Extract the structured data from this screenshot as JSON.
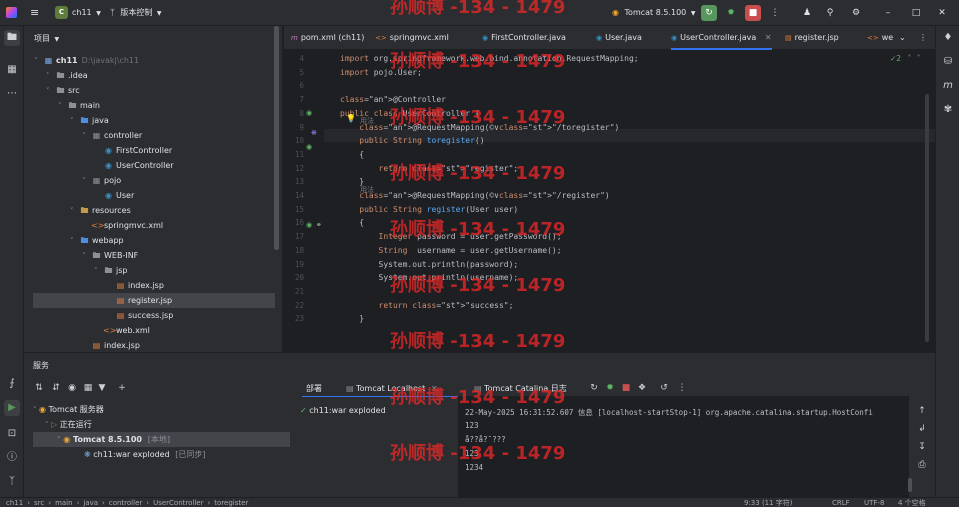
{
  "title_bar": {
    "project_badge": "C",
    "project_name": "ch11",
    "branch": "版本控制",
    "run_config": "Tomcat 8.5.100"
  },
  "project_panel": {
    "title": "项目",
    "tree": [
      {
        "label": "ch11",
        "hint": "D:\\javakj\\ch11",
        "icon": "module-icon"
      },
      {
        "label": ".idea",
        "icon": "folder-icon"
      },
      {
        "label": "src",
        "icon": "folder-icon"
      },
      {
        "label": "main",
        "icon": "folder-icon"
      },
      {
        "label": "java",
        "icon": "source-folder-icon"
      },
      {
        "label": "controller",
        "icon": "package-icon"
      },
      {
        "label": "FirstController",
        "icon": "class-icon"
      },
      {
        "label": "UserController",
        "icon": "class-icon"
      },
      {
        "label": "pojo",
        "icon": "package-icon"
      },
      {
        "label": "User",
        "icon": "class-icon"
      },
      {
        "label": "resources",
        "icon": "resources-folder-icon"
      },
      {
        "label": "springmvc.xml",
        "icon": "xml-file-icon"
      },
      {
        "label": "webapp",
        "icon": "web-folder-icon"
      },
      {
        "label": "WEB-INF",
        "icon": "folder-icon"
      },
      {
        "label": "jsp",
        "icon": "folder-icon"
      },
      {
        "label": "index.jsp",
        "icon": "jsp-file-icon"
      },
      {
        "label": "register.jsp",
        "icon": "jsp-file-icon"
      },
      {
        "label": "success.jsp",
        "icon": "jsp-file-icon"
      },
      {
        "label": "web.xml",
        "icon": "xml-file-icon"
      },
      {
        "label": "index.jsp",
        "icon": "jsp-file-icon"
      }
    ]
  },
  "editor_tabs": [
    {
      "label": "pom.xml (ch11)",
      "icon": "maven-icon"
    },
    {
      "label": "springmvc.xml",
      "icon": "xml-file-icon"
    },
    {
      "label": "FirstController.java",
      "icon": "class-icon"
    },
    {
      "label": "User.java",
      "icon": "class-icon"
    },
    {
      "label": "UserController.java",
      "icon": "class-icon",
      "active": true
    },
    {
      "label": "register.jsp",
      "icon": "jsp-file-icon"
    },
    {
      "label": "we",
      "icon": "xml-file-icon"
    }
  ],
  "editor": {
    "inspection_count": "2",
    "lines": [
      {
        "num": "4",
        "code": "import org.springframework.web.bind.annotation.RequestMapping;"
      },
      {
        "num": "5",
        "code": "import pojo.User;"
      },
      {
        "num": "6",
        "code": ""
      },
      {
        "num": "7",
        "code": "@Controller"
      },
      {
        "num": "8",
        "code": "public class UserController {"
      },
      {
        "num": "9",
        "code": "    @RequestMapping(©∨\"/toregister\")"
      },
      {
        "num": "10",
        "code": "    public String toregister()"
      },
      {
        "num": "11",
        "code": "    {"
      },
      {
        "num": "12",
        "code": "        return \"register\";"
      },
      {
        "num": "13",
        "code": "    }"
      },
      {
        "num": "14",
        "code": "    @RequestMapping(©∨\"/register\")"
      },
      {
        "num": "15",
        "code": "    public String register(User user)"
      },
      {
        "num": "16",
        "code": "    {"
      },
      {
        "num": "17",
        "code": "        Integer password = user.getPassword();"
      },
      {
        "num": "18",
        "code": "        String  username = user.getUsername();"
      },
      {
        "num": "19",
        "code": "        System.out.println(password);"
      },
      {
        "num": "20",
        "code": "        System.out.println(username);"
      },
      {
        "num": "21",
        "code": ""
      },
      {
        "num": "22",
        "code": "        return \"success\";"
      },
      {
        "num": "23",
        "code": "    }"
      }
    ],
    "usage_hint": "用法"
  },
  "services": {
    "title": "服务",
    "tree": [
      {
        "label": "Tomcat 服务器"
      },
      {
        "label": "正在运行"
      },
      {
        "label": "Tomcat 8.5.100",
        "hint": "[本地]"
      },
      {
        "label": "ch11:war exploded",
        "hint": "[已同步]"
      }
    ],
    "deploy_item": "ch11:war exploded",
    "tabs": [
      {
        "label": "部署"
      },
      {
        "label": "Tomcat Localhost"
      },
      {
        "label": "Tomcat Catalina 日志"
      }
    ],
    "console_lines": [
      "22-May-2025 16:31:52.607 信息 [localhost-startStop-1] org.apache.catalina.startup.HostConfi",
      "123",
      "å??å?¯???",
      "123",
      "1234"
    ]
  },
  "status_bar": {
    "breadcrumbs": [
      "ch11",
      "src",
      "main",
      "java",
      "controller",
      "UserController",
      "toregister"
    ],
    "position": "9:33 (11 字符)",
    "line_sep": "CRLF",
    "encoding": "UTF-8",
    "indent": "4 个空格"
  },
  "watermark": {
    "text": "孙顺博 -134 - 1479"
  },
  "colors": {
    "accent": "#3574f0",
    "run_green": "#57965c",
    "stop_red": "#c94f4f",
    "watermark": "#e62828"
  }
}
